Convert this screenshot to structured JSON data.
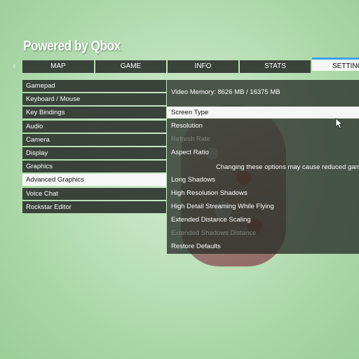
{
  "header": {
    "title": "Powered by Qbox"
  },
  "tabs": [
    {
      "label": "MAP"
    },
    {
      "label": "GAME"
    },
    {
      "label": "INFO"
    },
    {
      "label": "STATS"
    },
    {
      "label": "SETTINGS",
      "active": true
    }
  ],
  "settings_menu": [
    {
      "label": "Gamepad"
    },
    {
      "label": "Keyboard / Mouse"
    },
    {
      "label": "Key Bindings"
    },
    {
      "label": "Audio"
    },
    {
      "label": "Camera"
    },
    {
      "label": "Display"
    },
    {
      "label": "Graphics"
    },
    {
      "label": "Advanced Graphics",
      "selected": true
    },
    {
      "label": "Voice Chat"
    },
    {
      "label": "Rockstar Editor"
    }
  ],
  "advanced_graphics": {
    "video_memory": "Video Memory: 8626 MB / 16375 MB",
    "warning": "Changing these options may cause reduced game",
    "options": [
      {
        "label": "Screen Type",
        "selected": true
      },
      {
        "label": "Resolution"
      },
      {
        "label": "Refresh Rate",
        "disabled": true
      },
      {
        "label": "Aspect Ratio"
      },
      {
        "label": "Long Shadows"
      },
      {
        "label": "High Resolution Shadows"
      },
      {
        "label": "High Detail Streaming While Flying"
      },
      {
        "label": "Extended Distance Scaling"
      },
      {
        "label": "Extended Shadows Distance",
        "disabled": true
      },
      {
        "label": "Restore Defaults"
      }
    ]
  },
  "colors": {
    "panel_dark": "#39433a",
    "selected_bg": "#f6f6f6",
    "active_tab_accent": "#3aa3e6",
    "background_green": "#bfe2bd"
  }
}
